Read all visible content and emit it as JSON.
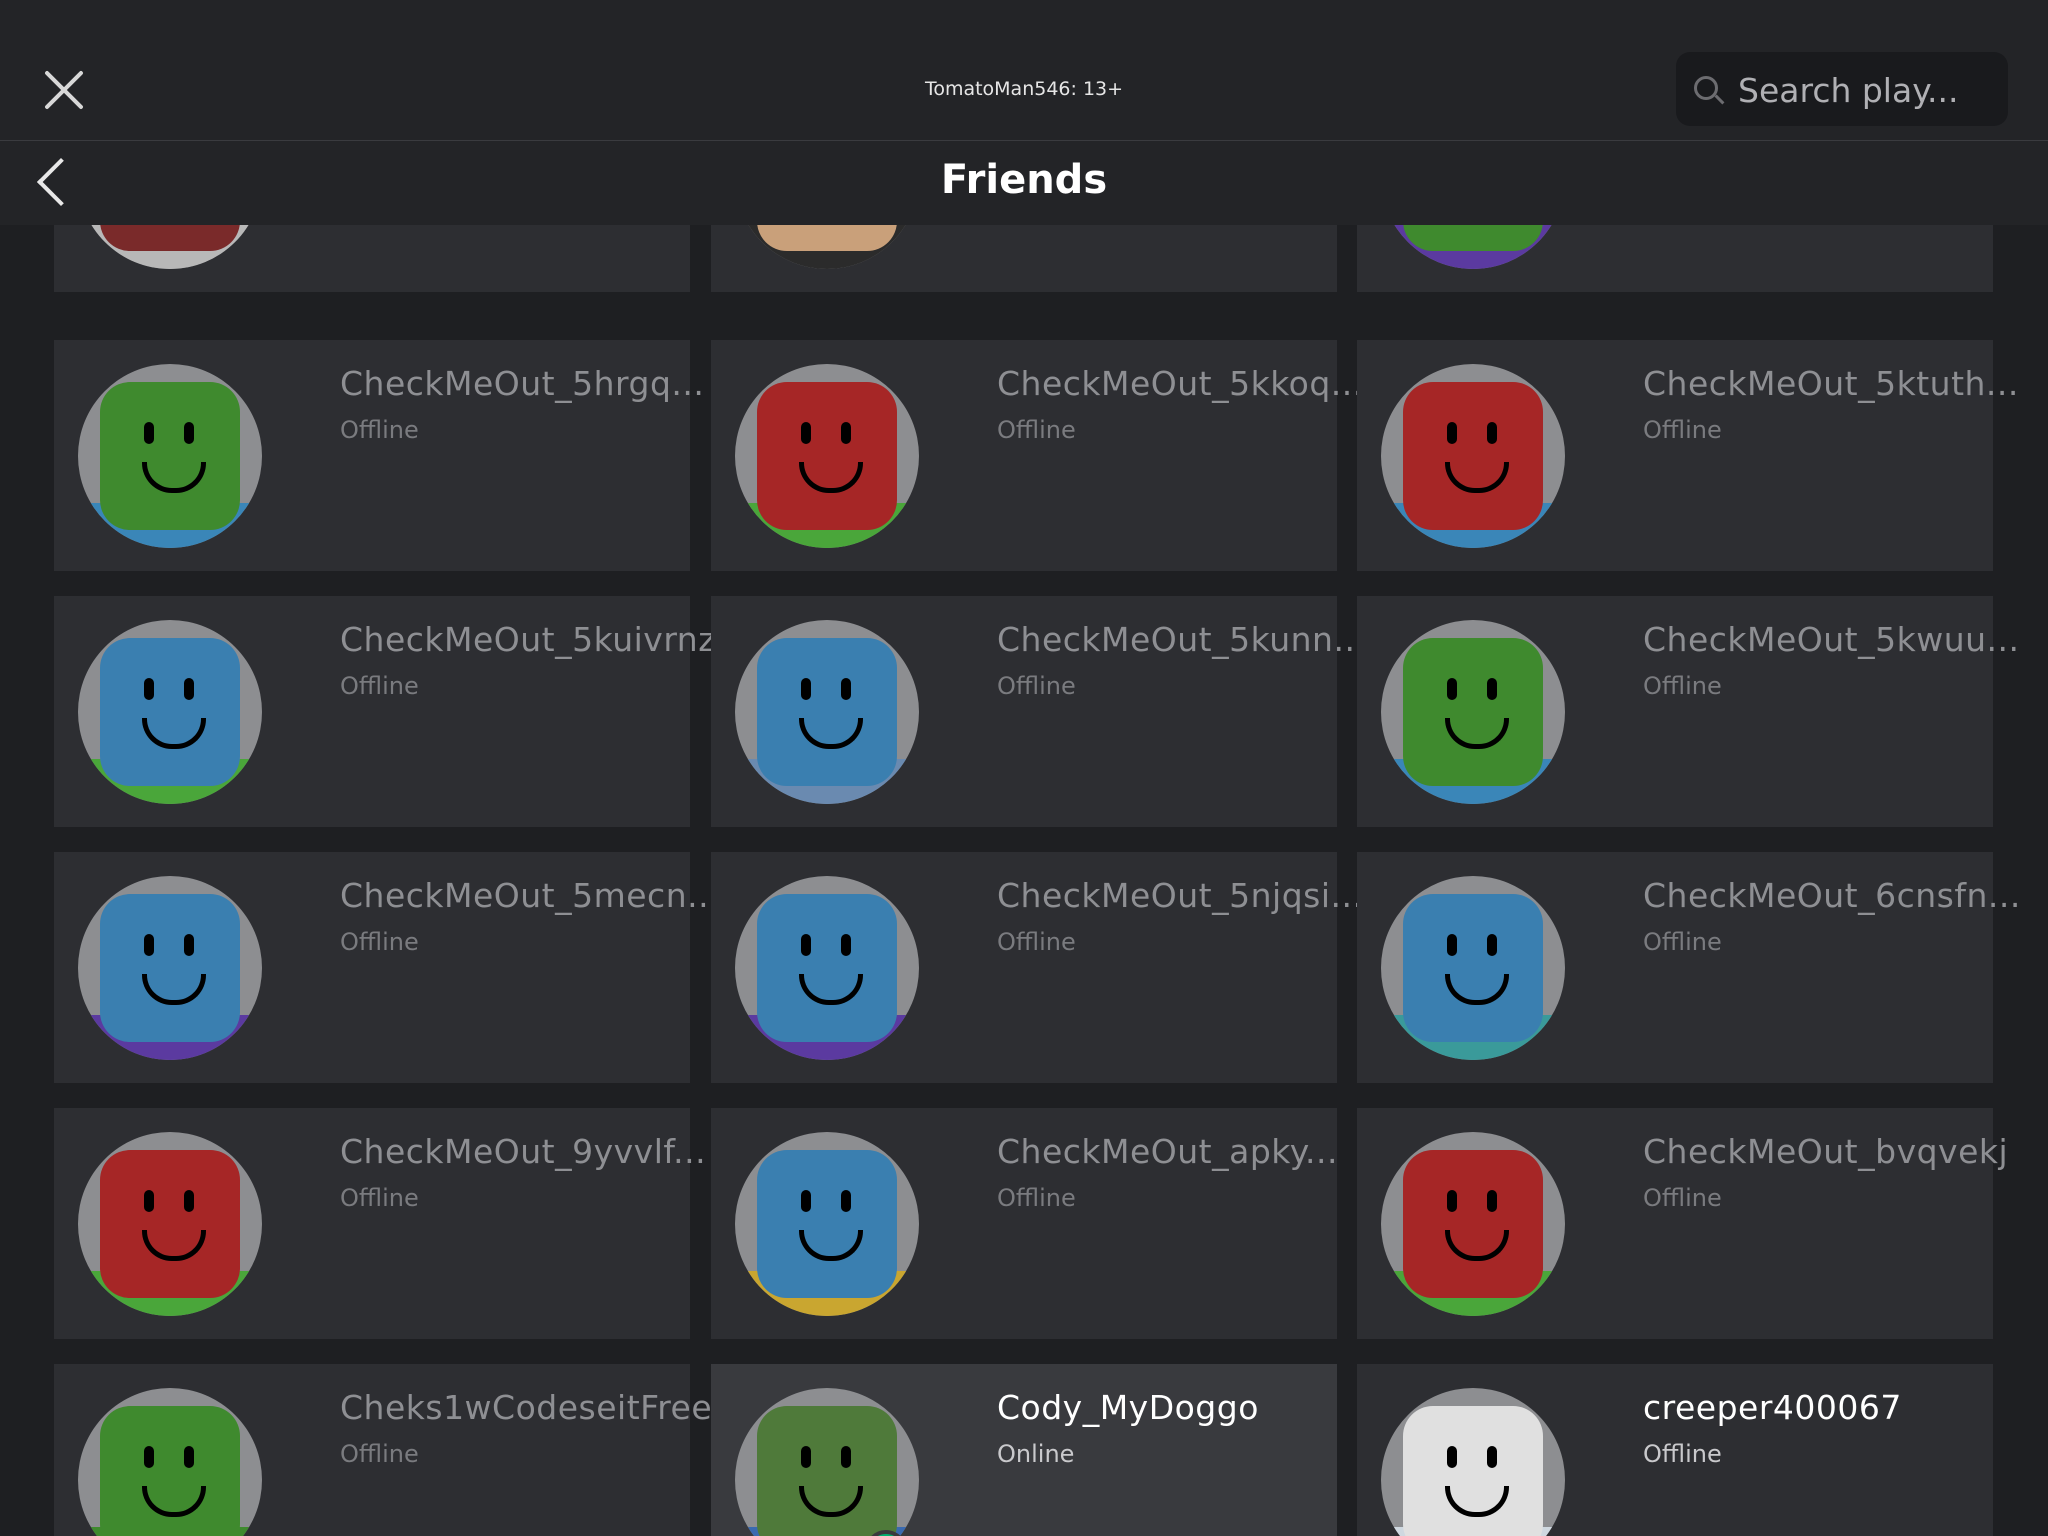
{
  "topbar": {
    "account_label": "TomatoMan546: 13+",
    "search_placeholder": "Search play..."
  },
  "header": {
    "title": "Friends"
  },
  "partial_row": [
    {
      "head_color": "#7a2a2a",
      "base_color": "#b8b8b8"
    },
    {
      "head_color": "#c9a07a",
      "base_color": "#2b2b2b"
    },
    {
      "head_color": "#3f8a2e",
      "base_color": "#5b3aa0"
    }
  ],
  "friends": [
    {
      "name": "CheckMeOut_5hrgq...",
      "status": "Offline",
      "head_color": "#3f8a2e",
      "base_color": "#3a86b8"
    },
    {
      "name": "CheckMeOut_5kkoq...",
      "status": "Offline",
      "head_color": "#a62626",
      "base_color": "#4aa63a"
    },
    {
      "name": "CheckMeOut_5ktuth...",
      "status": "Offline",
      "head_color": "#a62626",
      "base_color": "#3a86b8"
    },
    {
      "name": "CheckMeOut_5kuivrnz",
      "status": "Offline",
      "head_color": "#3a7fb0",
      "base_color": "#4aa63a"
    },
    {
      "name": "CheckMeOut_5kunn...",
      "status": "Offline",
      "head_color": "#3a7fb0",
      "base_color": "#6a8ab0"
    },
    {
      "name": "CheckMeOut_5kwuu...",
      "status": "Offline",
      "head_color": "#3f8a2e",
      "base_color": "#3a86b8"
    },
    {
      "name": "CheckMeOut_5mecn...",
      "status": "Offline",
      "head_color": "#3a7fb0",
      "base_color": "#5b3aa0"
    },
    {
      "name": "CheckMeOut_5njqsi...",
      "status": "Offline",
      "head_color": "#3a7fb0",
      "base_color": "#5b3aa0"
    },
    {
      "name": "CheckMeOut_6cnsfn...",
      "status": "Offline",
      "head_color": "#3a7fb0",
      "base_color": "#3a9a9a"
    },
    {
      "name": "CheckMeOut_9yvvlf...",
      "status": "Offline",
      "head_color": "#a62626",
      "base_color": "#4aa63a"
    },
    {
      "name": "CheckMeOut_apky...",
      "status": "Offline",
      "head_color": "#3a7fb0",
      "base_color": "#c9a630"
    },
    {
      "name": "CheckMeOut_bvqvekj",
      "status": "Offline",
      "head_color": "#a62626",
      "base_color": "#4aa63a"
    },
    {
      "name": "Cheks1wCodeseitFree",
      "status": "Offline",
      "head_color": "#3f8a2e",
      "base_color": "#3f8a2e"
    },
    {
      "name": "Cody_MyDoggo",
      "status": "Online",
      "head_color": "#4f7a3a",
      "base_color": "#3a6ab0"
    },
    {
      "name": "creeper400067",
      "status": "Offline",
      "head_color": "#e0e0e0",
      "base_color": "#cfd8e0"
    }
  ]
}
